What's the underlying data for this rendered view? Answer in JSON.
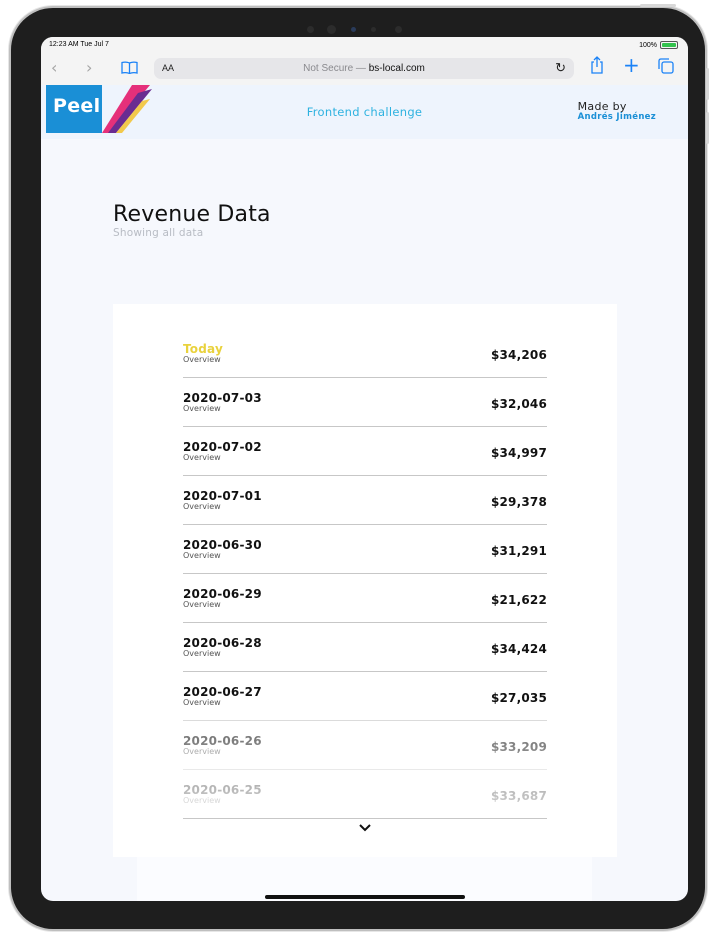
{
  "status": {
    "time": "12:23 AM  Tue Jul 7",
    "battery": "100%",
    "battery_level": 1.0
  },
  "browser": {
    "text_size": "AA",
    "security": "Not Secure —",
    "domain": "bs-local.com",
    "icons": [
      "back-icon",
      "forward-icon",
      "bookmarks-icon",
      "reload-icon",
      "share-icon",
      "new-tab-icon",
      "tabs-icon"
    ]
  },
  "header": {
    "logo": "Peel",
    "challenge": "Frontend challenge",
    "made_by": "Made by",
    "author": "Andrés Jiménez"
  },
  "page": {
    "title": "Revenue Data",
    "subtitle": "Showing all data"
  },
  "revenue": [
    {
      "date": "Today",
      "label": "Overview",
      "amount": "$34,206"
    },
    {
      "date": "2020-07-03",
      "label": "Overview",
      "amount": "$32,046"
    },
    {
      "date": "2020-07-02",
      "label": "Overview",
      "amount": "$34,997"
    },
    {
      "date": "2020-07-01",
      "label": "Overview",
      "amount": "$29,378"
    },
    {
      "date": "2020-06-30",
      "label": "Overview",
      "amount": "$31,291"
    },
    {
      "date": "2020-06-29",
      "label": "Overview",
      "amount": "$21,622"
    },
    {
      "date": "2020-06-28",
      "label": "Overview",
      "amount": "$34,424"
    },
    {
      "date": "2020-06-27",
      "label": "Overview",
      "amount": "$27,035"
    },
    {
      "date": "2020-06-26",
      "label": "Overview",
      "amount": "$33,209"
    },
    {
      "date": "2020-06-25",
      "label": "Overview",
      "amount": "$33,687"
    }
  ],
  "colors": {
    "accent": "#1a8fd6",
    "today": "#e9d23d",
    "challenge": "#2eb2e0",
    "logo_stripes": [
      "#e5307a",
      "#6a2c91",
      "#f2c94c"
    ]
  }
}
